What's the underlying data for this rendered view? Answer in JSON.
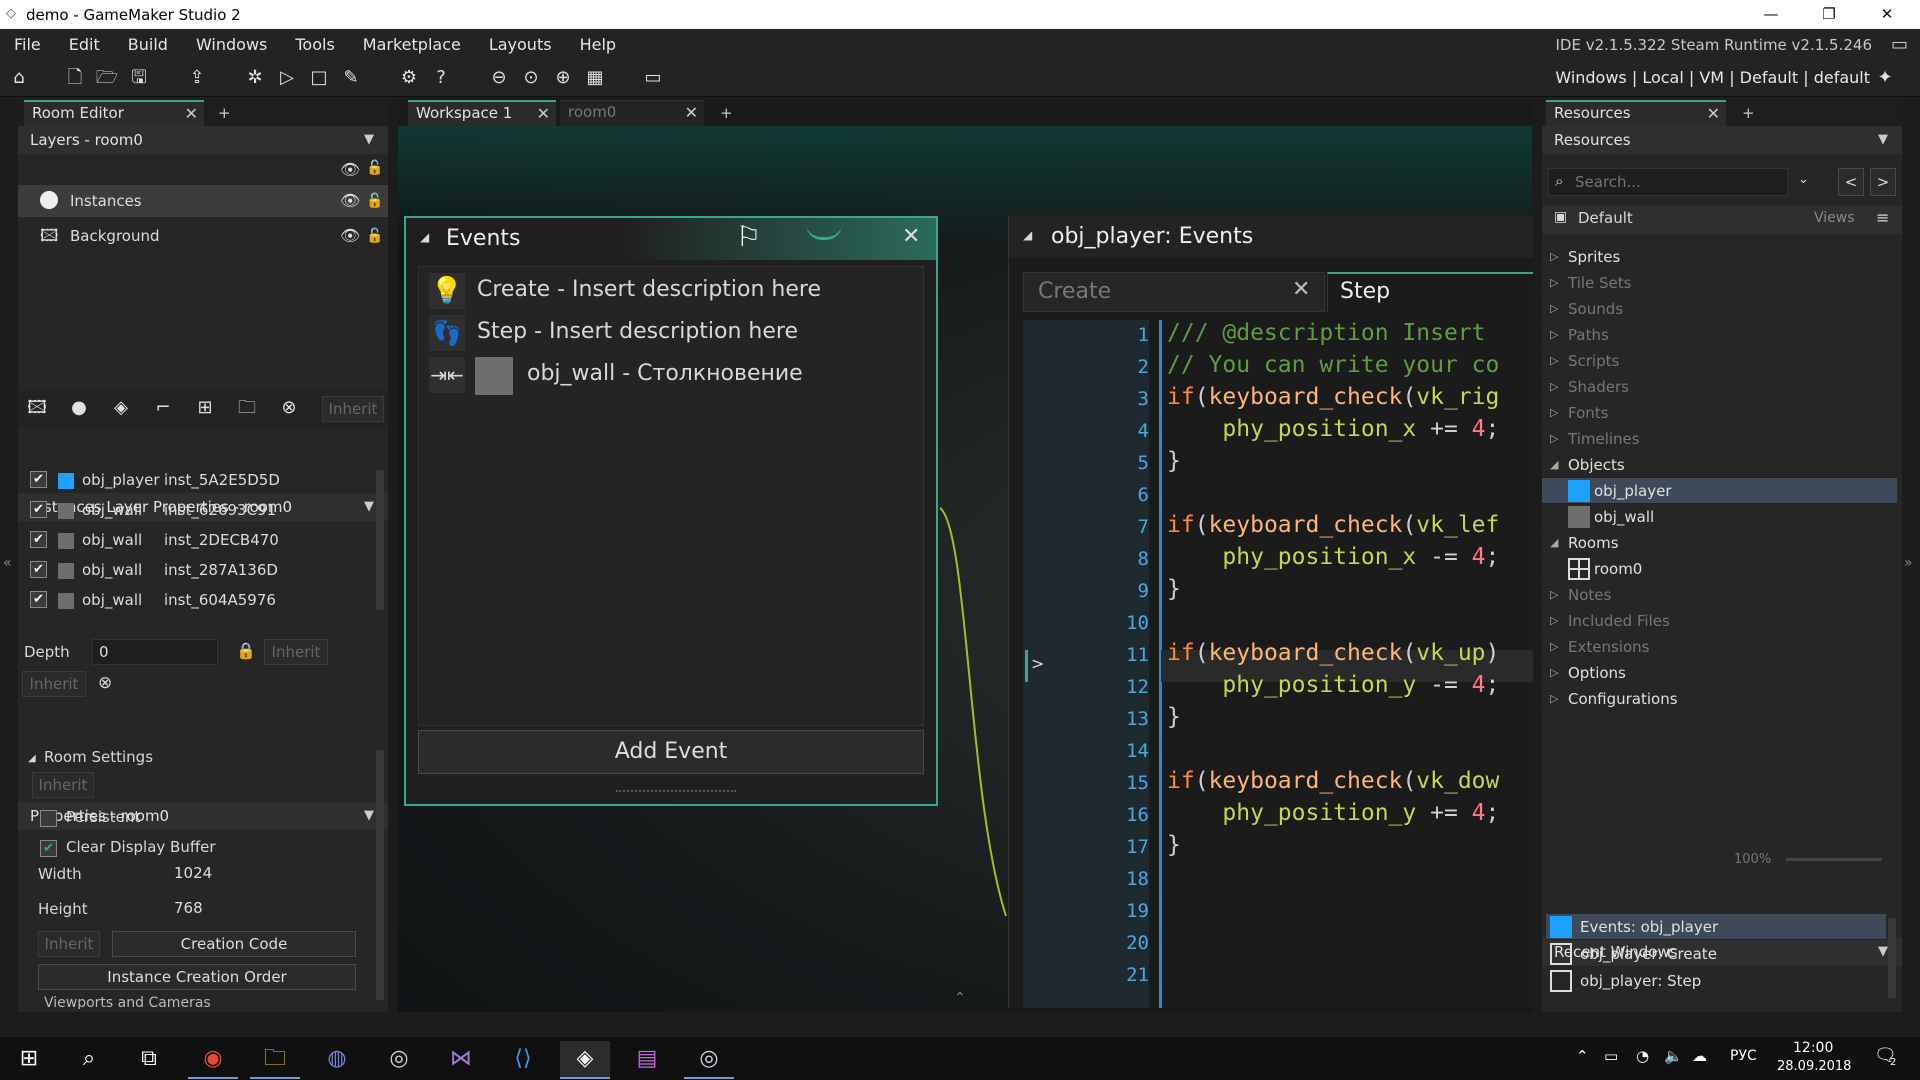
{
  "window": {
    "title": "demo - GameMaker Studio 2",
    "controls": [
      "—",
      "❐",
      "✕"
    ]
  },
  "menu": {
    "items": [
      "File",
      "Edit",
      "Build",
      "Windows",
      "Tools",
      "Marketplace",
      "Layouts",
      "Help"
    ],
    "version": "IDE v2.1.5.322 Steam Runtime v2.1.5.246"
  },
  "toolbar": {
    "targets": "Windows | Local | VM | Default | default"
  },
  "room_editor": {
    "tab": "Room Editor",
    "layers_header": "Layers - room0",
    "layers": [
      "Instances",
      "Background"
    ],
    "inherit_label": "Inherit",
    "instances_header": "Instances Layer Properties - room0",
    "instances": [
      {
        "object": "obj_player",
        "id": "inst_5A2E5D5D",
        "color": "#1ea0ff"
      },
      {
        "object": "obj_wall",
        "id": "inst_62693C91",
        "color": "#6e6e6e"
      },
      {
        "object": "obj_wall",
        "id": "inst_2DECB470",
        "color": "#6e6e6e"
      },
      {
        "object": "obj_wall",
        "id": "inst_287A136D",
        "color": "#6e6e6e"
      },
      {
        "object": "obj_wall",
        "id": "inst_604A5976",
        "color": "#6e6e6e"
      }
    ],
    "depth_label": "Depth",
    "depth_value": "0",
    "props_header": "Properties - room0",
    "room_settings": "Room Settings",
    "persistent": "Persistent",
    "clear_display": "Clear Display Buffer",
    "width_label": "Width",
    "width_value": "1024",
    "height_label": "Height",
    "height_value": "768",
    "creation_code": "Creation Code",
    "instance_order": "Instance Creation Order",
    "viewports": "Viewports and Cameras"
  },
  "workspace": {
    "tabs": [
      "Workspace 1",
      "room0"
    ]
  },
  "events": {
    "title": "Events",
    "items": [
      "Create - Insert description here",
      "Step - Insert description here",
      "obj_wall - Столкновение"
    ],
    "add_event": "Add Event"
  },
  "code_editor": {
    "title": "obj_player: Events",
    "tabs": [
      "Create",
      "Step"
    ],
    "line_numbers": [
      "1",
      "2",
      "3",
      "4",
      "5",
      "6",
      "7",
      "8",
      "9",
      "10",
      "11",
      "12",
      "13",
      "14",
      "15",
      "16",
      "17",
      "18",
      "19",
      "20",
      "21"
    ],
    "lines": [
      [
        [
          "cm",
          "/// @description Insert"
        ]
      ],
      [
        [
          "cm",
          "// You can write your co"
        ]
      ],
      [
        [
          "kw",
          "if"
        ],
        [
          "",
          "("
        ],
        [
          "fn",
          "keyboard_check"
        ],
        [
          "",
          "("
        ],
        [
          "vr",
          "vk_rig"
        ]
      ],
      [
        [
          "",
          "    "
        ],
        [
          "vr",
          "phy_position_x"
        ],
        [
          "",
          " += "
        ],
        [
          "num",
          "4"
        ],
        [
          "",
          ";"
        ]
      ],
      [
        [
          "",
          "}"
        ]
      ],
      [
        [
          "",
          ""
        ]
      ],
      [
        [
          "kw",
          "if"
        ],
        [
          "",
          "("
        ],
        [
          "fn",
          "keyboard_check"
        ],
        [
          "",
          "("
        ],
        [
          "vr",
          "vk_lef"
        ]
      ],
      [
        [
          "",
          "    "
        ],
        [
          "vr",
          "phy_position_x"
        ],
        [
          "",
          " -= "
        ],
        [
          "num",
          "4"
        ],
        [
          "",
          ";"
        ]
      ],
      [
        [
          "",
          "}"
        ]
      ],
      [
        [
          "",
          ""
        ]
      ],
      [
        [
          "kw",
          "if"
        ],
        [
          "",
          "("
        ],
        [
          "fn",
          "keyboard_check"
        ],
        [
          "",
          "("
        ],
        [
          "vr",
          "vk_up"
        ],
        [
          "",
          ")"
        ]
      ],
      [
        [
          "",
          "    "
        ],
        [
          "vr",
          "phy_position_y"
        ],
        [
          "",
          " -= "
        ],
        [
          "num",
          "4"
        ],
        [
          "",
          ";"
        ]
      ],
      [
        [
          "",
          "}"
        ]
      ],
      [
        [
          "",
          ""
        ]
      ],
      [
        [
          "kw",
          "if"
        ],
        [
          "",
          "("
        ],
        [
          "fn",
          "keyboard_check"
        ],
        [
          "",
          "("
        ],
        [
          "vr",
          "vk_dow"
        ]
      ],
      [
        [
          "",
          "    "
        ],
        [
          "vr",
          "phy_position_y"
        ],
        [
          "",
          " += "
        ],
        [
          "num",
          "4"
        ],
        [
          "",
          ";"
        ]
      ],
      [
        [
          "",
          "}"
        ]
      ],
      [
        [
          "",
          ""
        ]
      ],
      [
        [
          "",
          ""
        ]
      ],
      [
        [
          "",
          ""
        ]
      ],
      [
        [
          "",
          ""
        ]
      ]
    ]
  },
  "resources": {
    "tab": "Resources",
    "header": "Resources",
    "search_placeholder": "Search...",
    "default_label": "Default",
    "views_label": "Views",
    "tree": [
      {
        "label": "Sprites",
        "dim": false,
        "open": false
      },
      {
        "label": "Tile Sets",
        "dim": true,
        "open": false
      },
      {
        "label": "Sounds",
        "dim": true,
        "open": false
      },
      {
        "label": "Paths",
        "dim": true,
        "open": false
      },
      {
        "label": "Scripts",
        "dim": true,
        "open": false
      },
      {
        "label": "Shaders",
        "dim": true,
        "open": false
      },
      {
        "label": "Fonts",
        "dim": true,
        "open": false
      },
      {
        "label": "Timelines",
        "dim": true,
        "open": false
      },
      {
        "label": "Objects",
        "dim": false,
        "open": true
      },
      {
        "label": "obj_player",
        "child": true,
        "selected": true,
        "color": "#1ea0ff"
      },
      {
        "label": "obj_wall",
        "child": true,
        "color": "#6e6e6e"
      },
      {
        "label": "Rooms",
        "dim": false,
        "open": true
      },
      {
        "label": "room0",
        "child": true,
        "room": true
      },
      {
        "label": "Notes",
        "dim": true,
        "open": false
      },
      {
        "label": "Included Files",
        "dim": true,
        "open": false
      },
      {
        "label": "Extensions",
        "dim": true,
        "open": false
      },
      {
        "label": "Options",
        "dim": false,
        "open": false
      },
      {
        "label": "Configurations",
        "dim": false,
        "open": false
      }
    ],
    "zoom": "100%",
    "recent_header": "Recent Windows",
    "recent": [
      "Events: obj_player",
      "obj_player: Create",
      "obj_player: Step"
    ]
  },
  "taskbar": {
    "lang": "РУС",
    "time": "12:00",
    "date": "28.09.2018",
    "notif": "2"
  }
}
